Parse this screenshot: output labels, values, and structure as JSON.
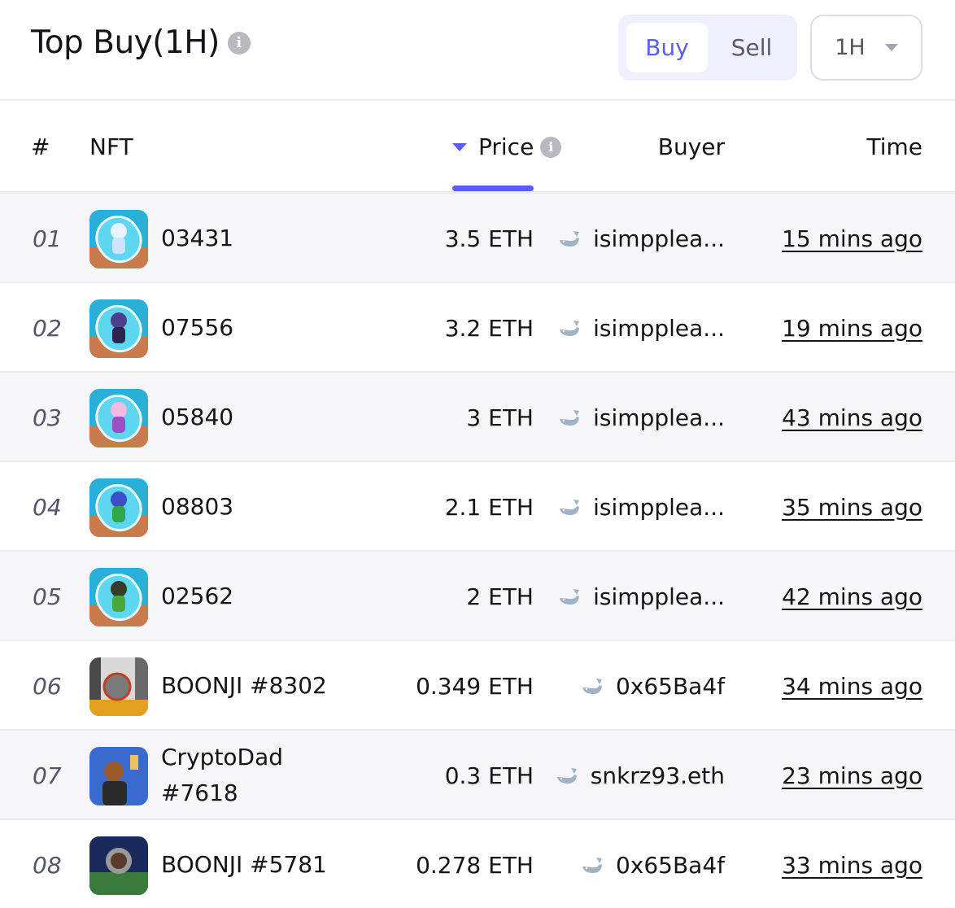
{
  "header": {
    "title": "Top Buy(1H)",
    "info_icon": "info-icon",
    "toggle": {
      "buy_label": "Buy",
      "sell_label": "Sell",
      "selected": "Buy"
    },
    "period": {
      "value": "1H"
    }
  },
  "table": {
    "columns": {
      "rank": "#",
      "nft": "NFT",
      "price": "Price",
      "buyer": "Buyer",
      "time": "Time"
    },
    "sort": {
      "column": "Price",
      "direction": "desc"
    },
    "rows": [
      {
        "rank": "01",
        "nft": "03431",
        "price": "3.5 ETH",
        "buyer": "isimpplea...",
        "time": "15 mins ago"
      },
      {
        "rank": "02",
        "nft": "07556",
        "price": "3.2 ETH",
        "buyer": "isimpplea...",
        "time": "19 mins ago"
      },
      {
        "rank": "03",
        "nft": "05840",
        "price": "3 ETH",
        "buyer": "isimpplea...",
        "time": "43 mins ago"
      },
      {
        "rank": "04",
        "nft": "08803",
        "price": "2.1 ETH",
        "buyer": "isimpplea...",
        "time": "35 mins ago"
      },
      {
        "rank": "05",
        "nft": "02562",
        "price": "2 ETH",
        "buyer": "isimpplea...",
        "time": "42 mins ago"
      },
      {
        "rank": "06",
        "nft": "BOONJI #8302",
        "price": "0.349 ETH",
        "buyer": "0x65Ba4f",
        "time": "34 mins ago"
      },
      {
        "rank": "07",
        "nft": "CryptoDad #7618",
        "price": "0.3 ETH",
        "buyer": "snkrz93.eth",
        "time": "23 mins ago"
      },
      {
        "rank": "08",
        "nft": "BOONJI #5781",
        "price": "0.278 ETH",
        "buyer": "0x65Ba4f",
        "time": "33 mins ago"
      }
    ]
  },
  "colors": {
    "accent": "#5b5ef0",
    "row_alt": "#f6f6f8",
    "divider": "#ececf0"
  }
}
